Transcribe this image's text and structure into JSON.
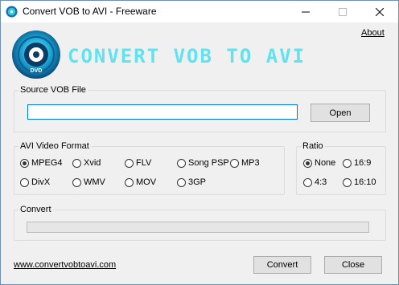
{
  "window": {
    "title": "Convert VOB to AVI - Freeware",
    "minimize_icon": "minimize-icon",
    "maximize_icon": "maximize-icon",
    "close_icon": "close-icon"
  },
  "header": {
    "about_link": "About",
    "logo_text": "CONVERT VOB TO AVI",
    "logo_disc_label": "DVD"
  },
  "source": {
    "group_title": "Source VOB File",
    "path_value": "",
    "open_button": "Open"
  },
  "format": {
    "group_title": "AVI Video Format",
    "options": [
      "MPEG4",
      "Xvid",
      "FLV",
      "Song PSP",
      "MP3",
      "DivX",
      "WMV",
      "MOV",
      "3GP"
    ],
    "selected": "MPEG4"
  },
  "ratio": {
    "group_title": "Ratio",
    "options": [
      "None",
      "16:9",
      "4:3",
      "16:10"
    ],
    "selected": "None"
  },
  "convert": {
    "group_title": "Convert",
    "progress": 0
  },
  "footer": {
    "website_link": "www.convertvobtoavi.com",
    "convert_button": "Convert",
    "close_button": "Close"
  },
  "colors": {
    "logo_text": "#5fe3ee",
    "focus_border": "#0078d7"
  }
}
